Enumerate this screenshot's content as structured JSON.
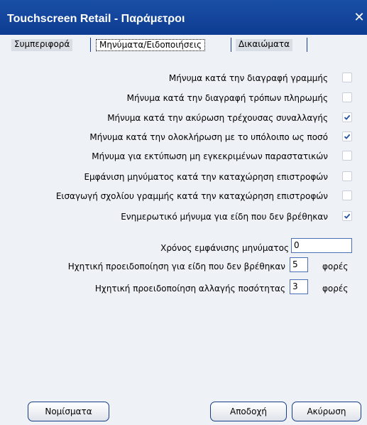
{
  "window": {
    "title": "Touchscreen Retail - Παράμετροι"
  },
  "tabs": [
    {
      "label": "Συμπεριφορά"
    },
    {
      "label": "Μηνύματα/Ειδοποιήσεις"
    },
    {
      "label": "Δικαιώματα"
    }
  ],
  "options": [
    {
      "label": "Μήνυμα κατά την διαγραφή γραμμής",
      "checked": false
    },
    {
      "label": "Μήνυμα κατά την διαγραφή τρόπων πληρωμής",
      "checked": false
    },
    {
      "label": "Μήνυμα κατά την ακύρωση τρέχουσας συναλλαγής",
      "checked": true
    },
    {
      "label": "Μήνυμα κατά την ολοκλήρωση με το υπόλοιπο ως ποσό",
      "checked": true
    },
    {
      "label": "Μήνυμα για εκτύπωση μη εγκεκριμένων παραστατικών",
      "checked": false
    },
    {
      "label": "Εμφάνιση μηνύματος κατά την καταχώρηση επιστροφών",
      "checked": false
    },
    {
      "label": "Εισαγωγή σχολίου γραμμής κατά την καταχώρηση επιστροφών",
      "checked": false
    },
    {
      "label": "Ενημερωτικό μήνυμα για είδη που δεν βρέθηκαν",
      "checked": true
    }
  ],
  "fields": {
    "message_time": {
      "label": "Χρόνος εμφάνισης μηνύματος",
      "value": "0"
    },
    "beep_not_found": {
      "label": "Ηχητική προειδοποίηση για είδη που δεν βρέθηκαν",
      "value": "5",
      "unit": "φορές"
    },
    "beep_qty_change": {
      "label": "Ηχητική προειδοποίηση αλλαγής ποσότητας",
      "value": "3",
      "unit": "φορές"
    }
  },
  "buttons": {
    "currencies": "Νομίσματα",
    "ok": "Αποδοχή",
    "cancel": "Ακύρωση"
  },
  "icons": {
    "close": "close-icon",
    "check": "checkmark-icon"
  },
  "colors": {
    "titlebar": "#0d3c92",
    "background": "#eef1f6",
    "check": "#1f4fa8"
  }
}
